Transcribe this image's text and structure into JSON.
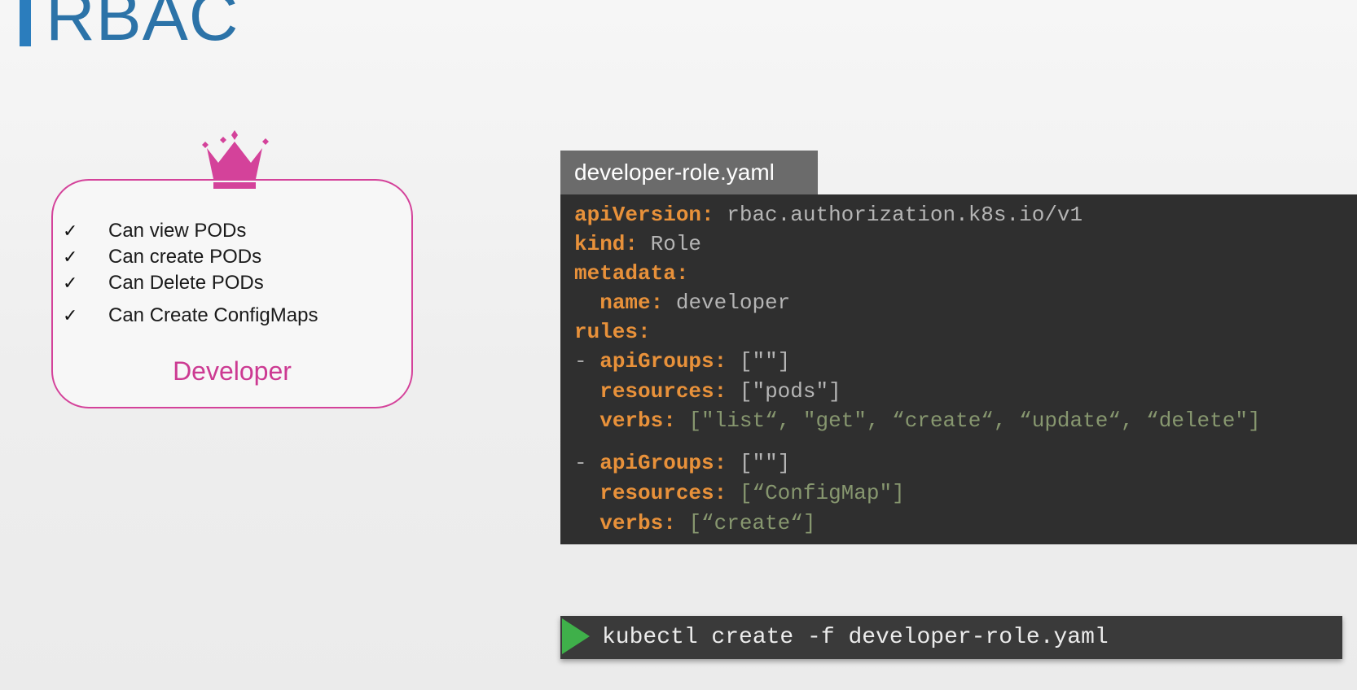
{
  "slide": {
    "title": "RBAC"
  },
  "role": {
    "name": "Developer",
    "permissions": [
      "Can view PODs",
      "Can create PODs",
      "Can Delete PODs",
      "Can Create ConfigMaps"
    ],
    "check_glyph": "✓",
    "icon": "crown-icon",
    "accent_color": "#d4429a"
  },
  "yaml_file": {
    "filename": "developer-role.yaml",
    "lines": [
      {
        "indent": "",
        "key": "apiVersion:",
        "value": "rbac.authorization.k8s.io/v1"
      },
      {
        "indent": "",
        "key": "kind:",
        "value": "Role"
      },
      {
        "indent": "",
        "key": "metadata:",
        "value": ""
      },
      {
        "indent": "  ",
        "key": "name:",
        "value": "developer"
      },
      {
        "indent": "",
        "key": "rules:",
        "value": ""
      },
      {
        "indent": "- ",
        "key": "apiGroups:",
        "value": "[\"\"]"
      },
      {
        "indent": "  ",
        "key": "resources:",
        "value": "[\"pods\"]"
      },
      {
        "indent": "  ",
        "key": "verbs:",
        "value": "[\"list“, \"get\", “create“, “update“, “delete\"]"
      },
      {
        "indent": "- ",
        "key": "apiGroups:",
        "value": "[\"\"]"
      },
      {
        "indent": "  ",
        "key": "resources:",
        "value": "[“ConfigMap\"]"
      },
      {
        "indent": "  ",
        "key": "verbs:",
        "value": "[“create“]"
      }
    ]
  },
  "terminal": {
    "command": "kubectl create -f developer-role.yaml",
    "icon": "play-icon"
  },
  "colors": {
    "title": "#2c73a8",
    "yaml_key": "#e8913a",
    "code_background": "#2f2f2f",
    "play": "#3fb04a"
  }
}
